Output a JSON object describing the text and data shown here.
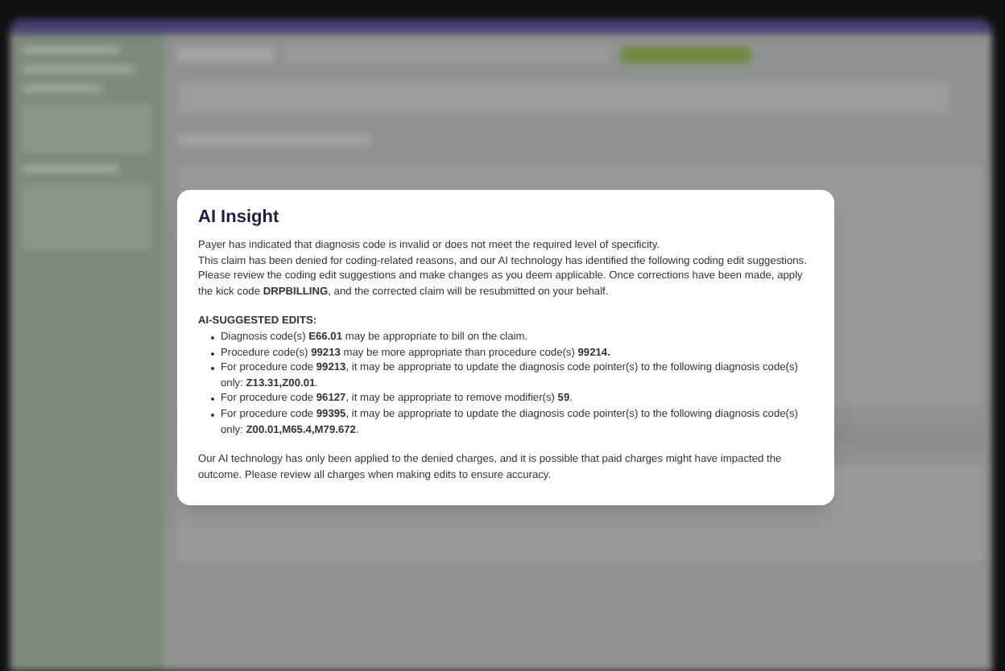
{
  "modal": {
    "title": "AI Insight",
    "intro": [
      "Payer has indicated that diagnosis code is invalid or does not meet the required level of specificity.",
      "This claim has been denied for coding-related reasons, and our AI technology has identified the following coding edit suggestions.",
      "Please review the coding edit suggestions and make changes as you deem applicable. Once corrections have been made, apply the kick code **DRPBILLING**, and the corrected claim will be resubmitted on your behalf."
    ],
    "edits_heading": "AI-SUGGESTED EDITS:",
    "edits": [
      "Diagnosis code(s) **E66.01** may be appropriate to bill on the claim.",
      "Procedure code(s) **99213** may be more appropriate than procedure code(s) **99214.**",
      "For procedure code **99213**, it may be appropriate to update the diagnosis code pointer(s) to the following diagnosis code(s) only: **Z13.31,Z00.01**.",
      "For procedure code **96127**, it may be appropriate to remove modifier(s) **59**.",
      "For procedure code **99395**, it may be appropriate to update the diagnosis code pointer(s) to the following diagnosis code(s) only: **Z00.01,M65.4,M79.672**."
    ],
    "footer": "Our AI technology has only been applied to the denied charges, and it is possible that paid charges might have impacted the outcome. Please review all charges when making edits to ensure accuracy."
  }
}
